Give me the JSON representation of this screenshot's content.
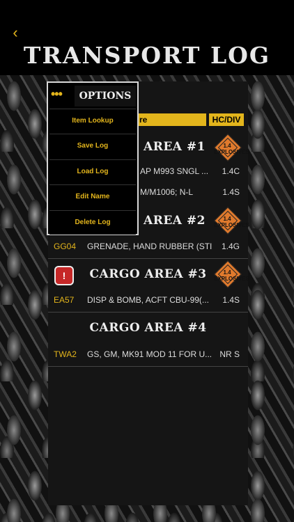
{
  "header": {
    "back_icon": "‹",
    "title": "TRANSPORT LOG"
  },
  "columns": {
    "name": "re",
    "hc_div": "HC/DIV"
  },
  "areas": [
    {
      "label": "AREA #1",
      "placard": "1.4 EXPLOSIVES"
    },
    {
      "label": "AREA #2",
      "placard": "1.4 EXPLOSIVES"
    },
    {
      "label": "CARGO AREA #3",
      "placard": "1.4 EXPLOSIVES"
    },
    {
      "label": "CARGO AREA #4"
    }
  ],
  "rows": [
    {
      "code": "",
      "desc": "AP M993 SNGL ...",
      "hc": "1.4C"
    },
    {
      "code": "",
      "desc": "M/M1006; N-L",
      "hc": "1.4S"
    },
    {
      "code": "GG04",
      "desc": "GRENADE, HAND RUBBER (STI...",
      "hc": "1.4G"
    },
    {
      "code": "EA57",
      "desc": "DISP & BOMB, ACFT CBU-99(...",
      "hc": "1.4S"
    },
    {
      "code": "TWA2",
      "desc": "GS, GM, MK91 MOD 11 FOR U...",
      "hc": "NR S"
    }
  ],
  "warning_icon": "!",
  "menu": {
    "dots": "•••",
    "title": "OPTIONS",
    "items": [
      "Item Lookup",
      "Save Log",
      "Load Log",
      "Edit Name",
      "Delete Log"
    ]
  },
  "colors": {
    "accent": "#e3b51c",
    "placard": "#e07a2d",
    "warning": "#c62828"
  }
}
